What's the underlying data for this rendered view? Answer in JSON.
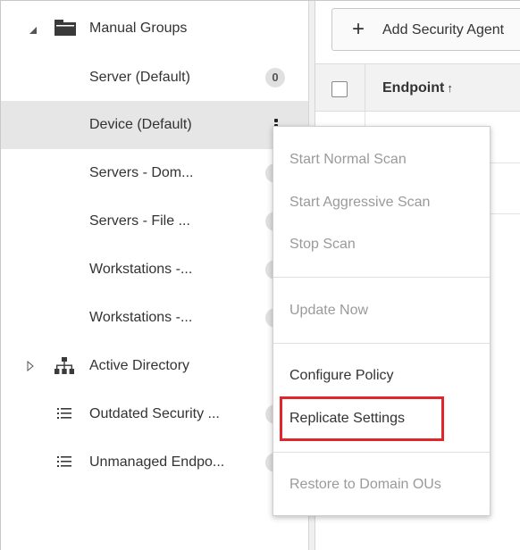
{
  "tree": {
    "root": {
      "label": "Manual Groups"
    },
    "groups": [
      {
        "label": "Server (Default)",
        "count": "0"
      },
      {
        "label": "Device (Default)"
      },
      {
        "label": "Servers - Dom..."
      },
      {
        "label": "Servers - File ..."
      },
      {
        "label": "Workstations -..."
      },
      {
        "label": "Workstations -..."
      }
    ],
    "active_directory": {
      "label": "Active Directory"
    },
    "filters": [
      {
        "label": "Outdated Security ..."
      },
      {
        "label": "Unmanaged Endpo..."
      }
    ]
  },
  "main": {
    "add_button_label": "Add Security Agent",
    "table": {
      "columns": [
        {
          "label": "Endpoint",
          "sort": "↑"
        }
      ]
    }
  },
  "context_menu": {
    "items": [
      {
        "label": "Start Normal Scan",
        "enabled": false
      },
      {
        "label": "Start Aggressive Scan",
        "enabled": false
      },
      {
        "label": "Stop Scan",
        "enabled": false
      },
      {
        "label": "Update Now",
        "enabled": false
      },
      {
        "label": "Configure Policy",
        "enabled": true
      },
      {
        "label": "Replicate Settings",
        "enabled": true,
        "highlighted": true
      },
      {
        "label": "Restore to Domain OUs",
        "enabled": false
      }
    ]
  },
  "colors": {
    "highlight_border": "#e0252b",
    "selected_row": "#e6e6e6",
    "disabled_text": "#9a9a9a"
  }
}
